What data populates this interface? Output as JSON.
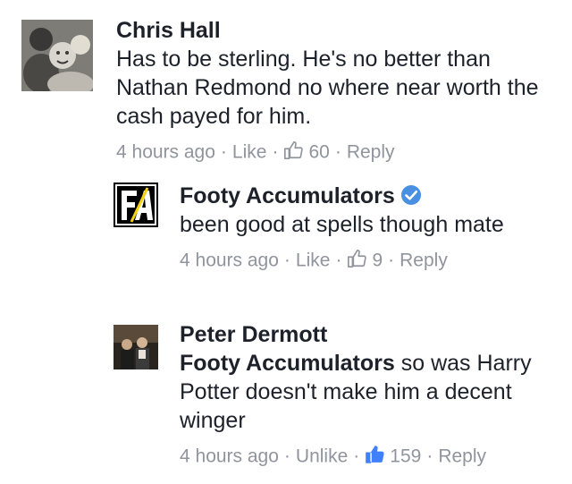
{
  "comments": [
    {
      "author": "Chris Hall",
      "text": "Has to be sterling. He's no better than Nathan Redmond no where near worth the cash payed for him.",
      "timestamp": "4 hours ago",
      "like_label": "Like",
      "like_count": "60",
      "reply_label": "Reply"
    },
    {
      "author": "Footy Accumulators",
      "verified": true,
      "text": "been good at spells though mate",
      "timestamp": "4 hours ago",
      "like_label": "Like",
      "like_count": "9",
      "reply_label": "Reply"
    },
    {
      "author": "Peter Dermott",
      "mention": "Footy Accumulators",
      "text": " so was Harry Potter doesn't make him a decent winger",
      "timestamp": "4 hours ago",
      "like_label": "Unlike",
      "like_count": "159",
      "reply_label": "Reply"
    }
  ],
  "colors": {
    "text": "#1d2129",
    "meta": "#90949c",
    "liked_blue": "#4080ff",
    "verified_blue": "#4a90e2"
  },
  "icons": [
    "thumbs-up-icon",
    "verified-badge-icon",
    "footy-accumulators-logo"
  ]
}
